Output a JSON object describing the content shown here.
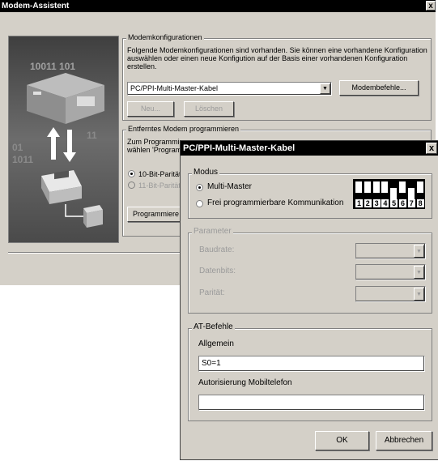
{
  "main_window": {
    "title": "Modem-Assistent",
    "close_glyph": "x",
    "art_text": {
      "row1": "10011  101",
      "row2": "11",
      "row3": "01",
      "row4": "1011"
    },
    "modem_config": {
      "group_label": "Modemkonfigurationen",
      "description": [
        "Folgende Modemkonfigurationen sind vorhanden. Sie können eine vorhandene Konfiguration",
        "auswählen oder einen neue Konfigution auf der Basis einer vorhandenen Konfiguration",
        "erstellen."
      ],
      "selected": "PC/PPI-Multi-Master-Kabel",
      "modem_commands_button": "Modembefehle...",
      "new_button": "Neu...",
      "delete_button": "Löschen"
    },
    "remote_modem": {
      "group_label": "Entferntes Modem programmieren",
      "text_line1": "Zum Programmie",
      "text_line2": "wählen 'Program",
      "radio1": "10-Bit-Parität",
      "radio2": "11-Bit-Parität",
      "program_button": "Programmiere"
    }
  },
  "dialog": {
    "title": "PC/PPI-Multi-Master-Kabel",
    "close_glyph": "x",
    "modus": {
      "group_label": "Modus",
      "option_multi": "Multi-Master",
      "option_free": "Frei programmierbare Kommunikation",
      "switch_numbers": [
        "1",
        "2",
        "3",
        "4",
        "5",
        "6",
        "7",
        "8"
      ],
      "switch_states": [
        "up",
        "up",
        "up",
        "up",
        "down",
        "up",
        "down",
        "up"
      ]
    },
    "parameter": {
      "group_label": "Parameter",
      "baudrate_label": "Baudrate:",
      "databits_label": "Datenbits:",
      "parity_label": "Parität:"
    },
    "at_commands": {
      "group_label": "AT-Befehle",
      "general_label": "Allgemein",
      "general_value": "S0=1",
      "auth_label": "Autorisierung Mobiltelefon",
      "auth_value": ""
    },
    "ok_button": "OK",
    "cancel_button": "Abbrechen"
  },
  "colors": {
    "title_bar": "#000000",
    "face": "#d4d0c8",
    "art_bg": "#555555"
  }
}
